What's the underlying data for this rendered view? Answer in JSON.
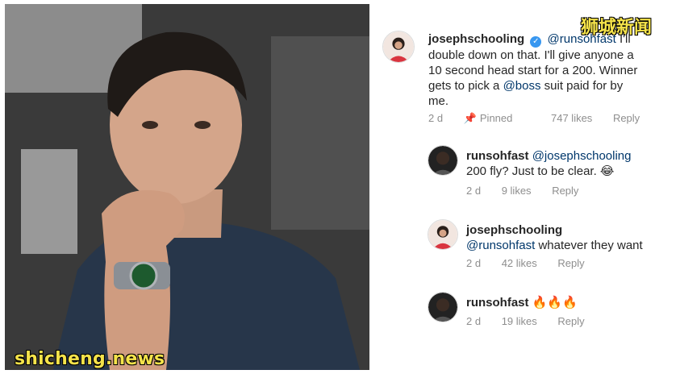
{
  "watermarks": {
    "bottom_left": "shicheng.news",
    "top_right": "狮城新闻"
  },
  "comments": [
    {
      "username": "josephschooling",
      "verified": true,
      "mention": "@runsohfast",
      "text_line1_tail": " I'll",
      "text_line2": "double down on that. I'll give anyone a",
      "text_line3": "10 second head start for a 200. Winner",
      "text_line4_pre": "gets to pick a ",
      "text_line4_mention": "@boss",
      "text_line4_post": " suit paid for by",
      "text_line5": "me.",
      "time": "2 d",
      "pinned": "Pinned",
      "likes": "747 likes",
      "reply": "Reply"
    },
    {
      "username": "runsohfast",
      "mention": "@josephschooling",
      "text": "200 fly? Just to be clear. 😂",
      "time": "2 d",
      "likes": "9 likes",
      "reply": "Reply"
    },
    {
      "username": "josephschooling",
      "mention": "@runsohfast",
      "text": " whatever they want",
      "time": "2 d",
      "likes": "42 likes",
      "reply": "Reply"
    },
    {
      "username": "runsohfast",
      "text": "🔥🔥🔥",
      "time": "2 d",
      "likes": "19 likes",
      "reply": "Reply"
    }
  ]
}
